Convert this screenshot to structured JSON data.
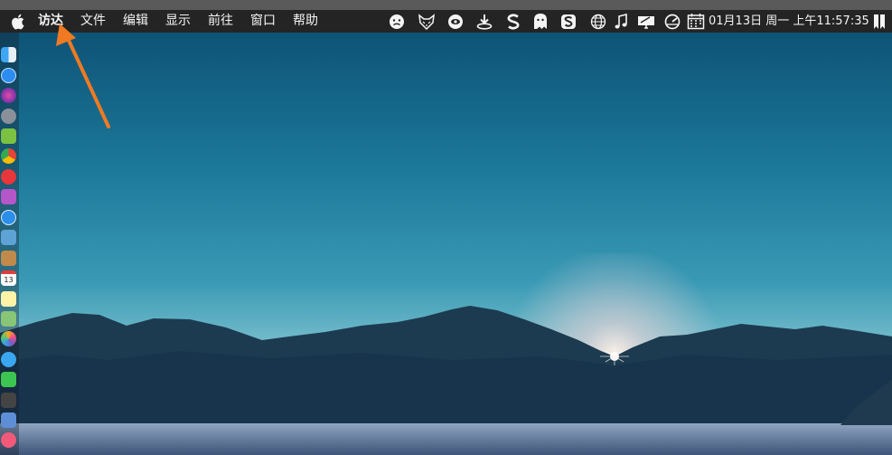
{
  "menubar": {
    "app_menu": "访达",
    "menus": [
      "文件",
      "编辑",
      "显示",
      "前往",
      "窗口",
      "帮助"
    ],
    "status_icons": [
      "face-icon",
      "fox-icon",
      "eye-icon",
      "download-icon",
      "s-icon",
      "ghost-icon",
      "sogou-icon",
      "globe-icon",
      "music-icon",
      "display-icon",
      "gauge-icon",
      "calendar-icon"
    ],
    "clock": "01月13日 周一 上午11:57:35",
    "colors": {
      "bar": "#242424",
      "text": "#f2f2f2"
    }
  },
  "dock": {
    "icons": [
      "finder-icon",
      "app-store-icon",
      "siri-icon",
      "launchpad-icon",
      "android-icon",
      "chrome-icon",
      "edge-icon",
      "notes-app-icon",
      "safari-icon",
      "preview-icon",
      "contacts-icon",
      "calendar-icon",
      "notes-icon",
      "maps-icon",
      "photos-icon",
      "messages-icon",
      "wechat-icon",
      "photo-booth-icon",
      "keynote-icon",
      "music-icon"
    ],
    "calendar_date": "13"
  },
  "annotation": {
    "color": "#f07a22"
  }
}
